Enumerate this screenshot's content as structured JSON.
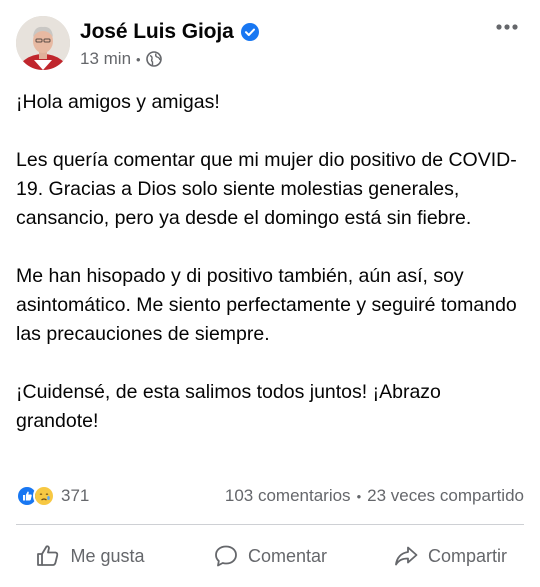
{
  "post": {
    "author": "José Luis Gioja",
    "timestamp": "13 min",
    "audience_icon": "globe-icon",
    "more_icon": "more-options-icon",
    "paragraphs": [
      "¡Hola amigos y amigas!",
      "Les quería comentar que mi mujer dio positivo de COVID-19. Gracias a Dios solo siente molestias generales, cansancio, pero ya desde el domingo está sin fiebre.",
      "Me han hisopado y di positivo también, aún así, soy asintomático. Me siento perfectamente y seguiré tomando las precauciones de siempre.",
      "¡Cuidensé, de esta salimos todos juntos! ¡Abrazo grandote!"
    ]
  },
  "stats": {
    "reaction_icons": [
      "like-reaction-icon",
      "care-reaction-icon"
    ],
    "reaction_count": "371",
    "comments": "103 comentarios",
    "separator": "•",
    "shares": "23 veces compartido"
  },
  "actions": {
    "like_label": "Me gusta",
    "comment_label": "Comentar",
    "share_label": "Compartir"
  },
  "colors": {
    "accent": "#1877f2",
    "secondary_text": "#65676b",
    "primary_text": "#050505",
    "divider": "#ced0d4"
  }
}
